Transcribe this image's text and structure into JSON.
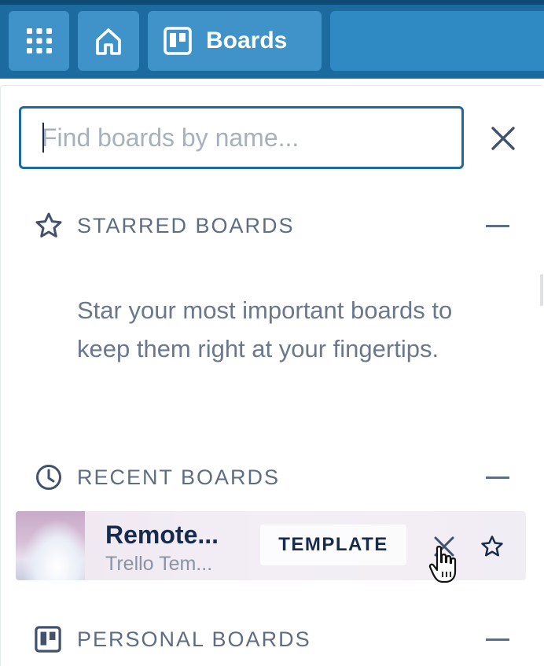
{
  "header": {
    "apps_icon": "grid-icon",
    "home_icon": "home-icon",
    "boards_icon": "trello-board-icon",
    "boards_label": "Boards",
    "colors": {
      "bar": "#1b6aa0",
      "button": "#3f93c8"
    }
  },
  "search": {
    "placeholder": "Find boards by name...",
    "value": "",
    "close_icon": "close-icon"
  },
  "starred": {
    "title": "STARRED BOARDS",
    "icon": "star-outline-icon",
    "empty_message": "Star your most important boards to keep them right at your fingertips."
  },
  "recent": {
    "title": "RECENT BOARDS",
    "icon": "clock-icon",
    "boards": [
      {
        "title": "Remote...",
        "subtitle": "Trello Tem...",
        "badge": "TEMPLATE",
        "close_icon": "close-icon",
        "star_icon": "star-outline-icon"
      }
    ]
  },
  "personal": {
    "title": "PERSONAL BOARDS",
    "icon": "trello-board-icon"
  }
}
